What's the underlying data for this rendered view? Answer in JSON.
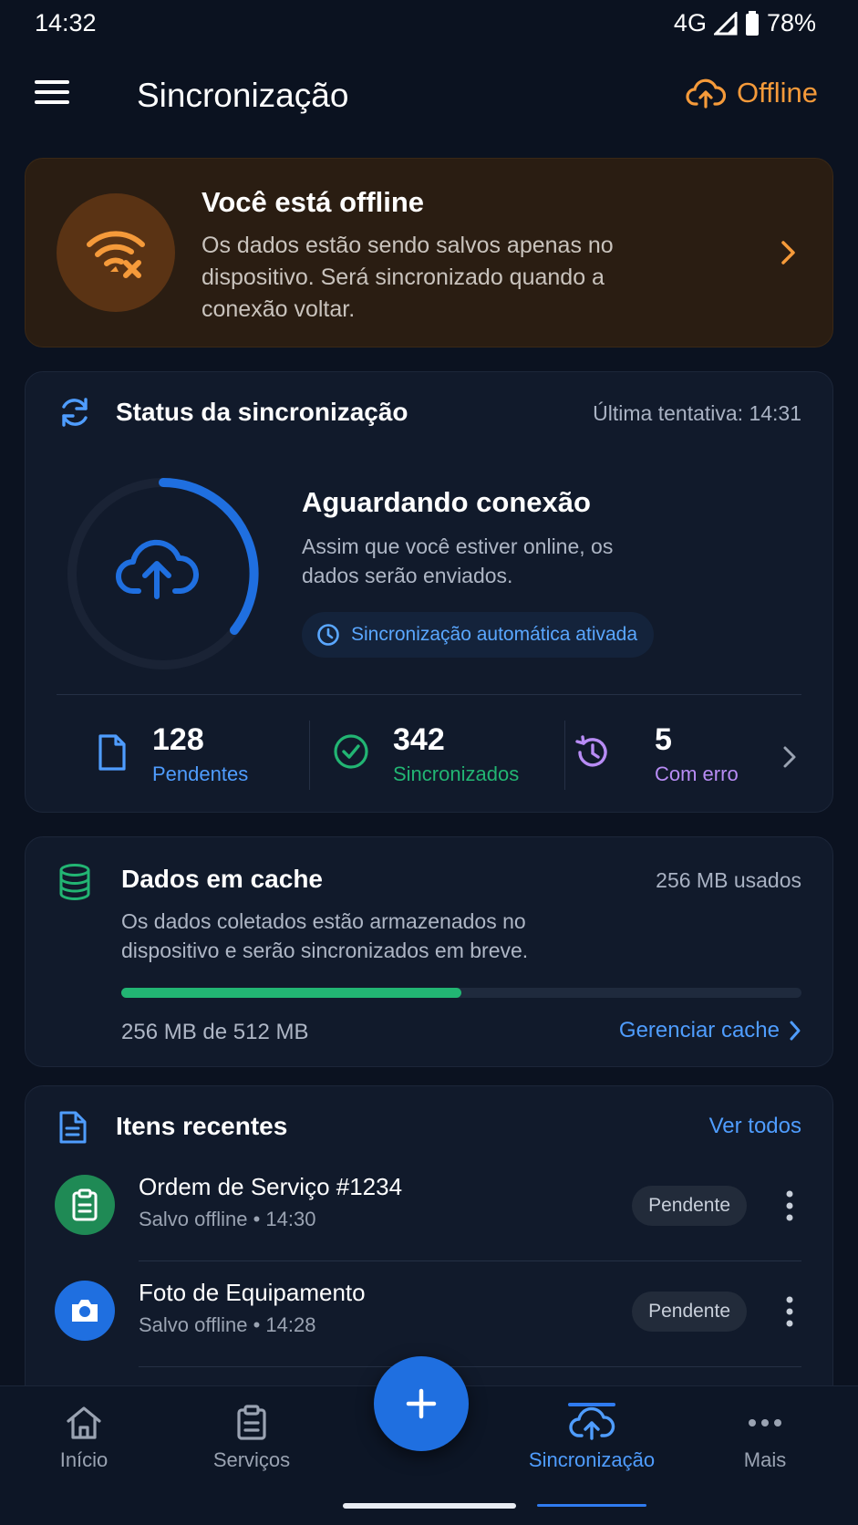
{
  "statusbar": {
    "time": "14:32",
    "network": "4G",
    "battery": "78%"
  },
  "appbar": {
    "title": "Sincronização",
    "status_label": "Offline",
    "status_color": "#f59a3a"
  },
  "banner": {
    "title": "Você está offline",
    "text": "Os dados estão sendo salvos apenas no dispositivo. Será sincronizado quando a conexão voltar."
  },
  "sync": {
    "title": "Status da sincronização",
    "last_attempt": "Última tentativa: 14:31",
    "state_title": "Aguardando conexão",
    "state_text": "Assim que você estiver online, os dados serão enviados.",
    "auto_sync_label": "Sincronização automática ativada",
    "stats": [
      {
        "value": "128",
        "label": "Pendentes",
        "color": "#4f9dff"
      },
      {
        "value": "342",
        "label": "Sincronizados",
        "color": "#22b573"
      },
      {
        "value": "5",
        "label": "Com erro",
        "color": "#b88cf5"
      }
    ]
  },
  "cache": {
    "title": "Dados em cache",
    "used": "256 MB usados",
    "text": "Os dados coletados estão armazenados no dispositivo e serão sincronizados em breve.",
    "usage_fraction": 0.5,
    "size_label": "256 MB de 512 MB",
    "manage_label": "Gerenciar cache"
  },
  "recent": {
    "title": "Itens recentes",
    "see_all": "Ver todos",
    "items": [
      {
        "title": "Ordem de Serviço #1234",
        "subtitle": "Salvo offline • 14:30",
        "badge": "Pendente",
        "icon": "clipboard-icon",
        "color": "#1f8a55"
      },
      {
        "title": "Foto de Equipamento",
        "subtitle": "Salvo offline • 14:28",
        "badge": "Pendente",
        "icon": "camera-icon",
        "color": "#1f6fe0"
      }
    ]
  },
  "nav": {
    "items": [
      {
        "label": "Início",
        "icon": "home-icon"
      },
      {
        "label": "Serviços",
        "icon": "clipboard-icon"
      },
      {
        "label": "Sincronização",
        "icon": "cloud-upload-icon",
        "active": true
      },
      {
        "label": "Mais",
        "icon": "more-icon"
      }
    ],
    "fab_icon": "plus-icon"
  }
}
